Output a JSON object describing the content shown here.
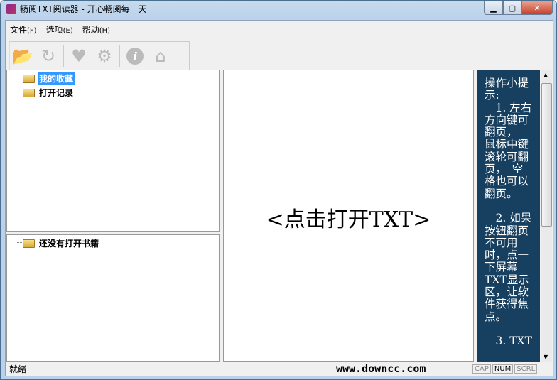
{
  "window": {
    "title": "畅阅TXT阅读器 - 开心畅阅每一天"
  },
  "menu": [
    {
      "label": "文件",
      "key": "(F)"
    },
    {
      "label": "选项",
      "key": "(E)"
    },
    {
      "label": "帮助",
      "key": "(H)"
    }
  ],
  "toolbar": {
    "open": "open-folder-icon",
    "refresh": "refresh-icon",
    "favorite": "add-favorite-icon",
    "settings": "gear-icon",
    "about": "info-icon",
    "home": "home-icon"
  },
  "tree": {
    "favorites": "我的收藏",
    "history": "打开记录"
  },
  "books": {
    "empty": "还没有打开书籍"
  },
  "reader": {
    "prompt": "<点击打开TXT>"
  },
  "tips": [
    "操作小提",
    "示:",
    "　1. 左右",
    "方向键可",
    "翻页，",
    "鼠标中键",
    "滚轮可翻",
    "页，　空",
    "格也可以",
    "翻页。",
    "",
    "　2. 如果",
    "按钮翻页",
    "不可用",
    "时，点一",
    "下屏幕",
    "TXT显示",
    "区，让软",
    "件获得焦",
    "点。",
    "",
    "　3. TXT"
  ],
  "status": {
    "text": "就绪",
    "watermark": "www.downcc.com",
    "cap": "CAP",
    "num": "NUM",
    "scrl": "SCRL"
  }
}
